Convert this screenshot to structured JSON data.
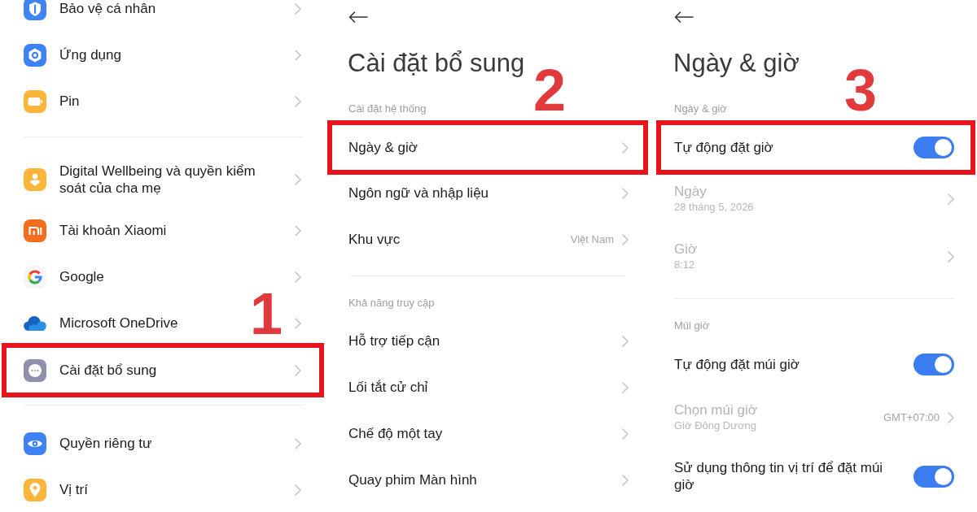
{
  "screens": [
    {
      "kind": "list",
      "step": "1",
      "groups": [
        {
          "items": [
            {
              "label": "Bảo vệ cá nhân",
              "highlighted": false
            },
            {
              "label": "Ứng dụng",
              "highlighted": false
            },
            {
              "label": "Pin",
              "highlighted": false
            }
          ]
        },
        {
          "items": [
            {
              "label": "Digital Wellbeing và quyền kiểm soát của cha mẹ",
              "highlighted": false
            },
            {
              "label": "Tài khoản Xiaomi",
              "highlighted": false
            },
            {
              "label": "Google",
              "highlighted": false
            },
            {
              "label": "Microsoft OneDrive",
              "highlighted": false
            },
            {
              "label": "Cài đặt bổ sung",
              "highlighted": true
            }
          ]
        },
        {
          "items": [
            {
              "label": "Quyền riêng tư",
              "highlighted": false
            },
            {
              "label": "Vị trí",
              "highlighted": false
            }
          ]
        }
      ]
    },
    {
      "kind": "page",
      "step": "2",
      "title": "Cài đặt bổ sung",
      "sections": [
        {
          "heading": "Cài đặt hệ thống",
          "items": [
            {
              "kind": "link",
              "label": "Ngày & giờ",
              "highlighted": true
            },
            {
              "kind": "link",
              "label": "Ngôn ngữ và nhập liệu",
              "highlighted": false
            },
            {
              "kind": "link",
              "label": "Khu vực",
              "value": "Việt Nam",
              "highlighted": false
            }
          ]
        },
        {
          "heading": "Khả năng truy cập",
          "items": [
            {
              "kind": "link",
              "label": "Hỗ trợ tiếp cận",
              "highlighted": false
            },
            {
              "kind": "link",
              "label": "Lối tắt cử chỉ",
              "highlighted": false
            },
            {
              "kind": "link",
              "label": "Chế độ một tay",
              "highlighted": false
            },
            {
              "kind": "link",
              "label": "Quay phim Màn hình",
              "highlighted": false
            }
          ]
        }
      ]
    },
    {
      "kind": "page",
      "step": "3",
      "title": "Ngày & giờ",
      "sections": [
        {
          "heading": "Ngày & giờ",
          "items": [
            {
              "kind": "toggle",
              "label": "Tự động đặt giờ",
              "on": true,
              "disabled": false,
              "highlighted": true
            },
            {
              "kind": "link",
              "label": "Ngày",
              "subtitle": "28 tháng 5, 2026",
              "disabled": true,
              "highlighted": false
            },
            {
              "kind": "link",
              "label": "Giờ",
              "subtitle": "8:12",
              "disabled": true,
              "highlighted": false
            }
          ]
        },
        {
          "heading": "Múi giờ",
          "items": [
            {
              "kind": "toggle",
              "label": "Tự động đặt múi giờ",
              "on": true,
              "disabled": false,
              "highlighted": false
            },
            {
              "kind": "link",
              "label": "Chọn múi giờ",
              "subtitle": "Giờ Đông Dương",
              "value": "GMT+07:00",
              "disabled": true,
              "highlighted": false
            },
            {
              "kind": "toggle",
              "label": "Sử dụng thông tin vị trí để đặt múi giờ",
              "on": true,
              "disabled": false,
              "highlighted": false
            }
          ]
        }
      ]
    }
  ]
}
